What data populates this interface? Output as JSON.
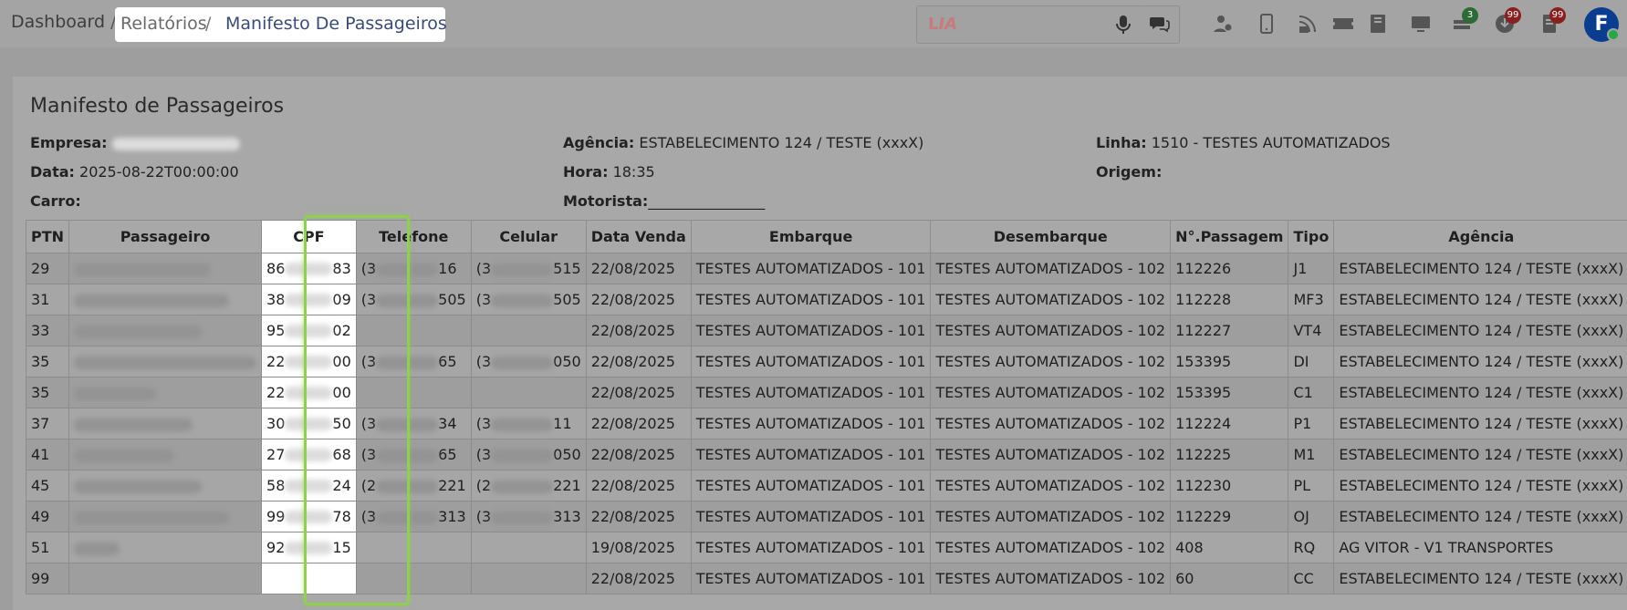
{
  "breadcrumb": {
    "dashboard": "Dashboard",
    "separator": "/",
    "reports": "Relatórios",
    "current": "Manifesto De Passageiros"
  },
  "search": {
    "brand_prefix": "L",
    "brand_suffix": "IA"
  },
  "toolbar": {
    "badges": {
      "green": "3",
      "red1": "99",
      "red2": "99"
    },
    "avatar_initial": "F"
  },
  "manifest": {
    "title": "Manifesto de Passageiros",
    "fields": {
      "empresa_label": "Empresa:",
      "data_label": "Data:",
      "data_value": "2025-08-22T00:00:00",
      "carro_label": "Carro:",
      "agencia_label": "Agência:",
      "agencia_value": "ESTABELECIMENTO 124 / TESTE (xxxX)",
      "hora_label": "Hora:",
      "hora_value": "18:35",
      "motorista_label": "Motorista:",
      "motorista_value": "________________",
      "linha_label": "Linha:",
      "linha_value": "1510 - TESTES AUTOMATIZADOS",
      "origem_label": "Origem:"
    },
    "columns": [
      "PTN",
      "Passageiro",
      "CPF",
      "Telefone",
      "Celular",
      "Data Venda",
      "Embarque",
      "Desembarque",
      "N°.Passagem",
      "Tipo",
      "Agência"
    ],
    "rows": [
      {
        "ptn": "29",
        "cpf_start": "86",
        "cpf_end": "83",
        "tel_start": "(3",
        "tel_end": "16",
        "cel_start": "(3",
        "cel_end": "515",
        "data": "22/08/2025",
        "emb": "TESTES AUTOMATIZADOS - 101",
        "des": "TESTES AUTOMATIZADOS - 102",
        "num": "112226",
        "tipo": "J1",
        "agencia": "ESTABELECIMENTO 124 / TESTE (xxxX)"
      },
      {
        "ptn": "31",
        "cpf_start": "38",
        "cpf_end": "09",
        "tel_start": "(3",
        "tel_end": "505",
        "cel_start": "(3",
        "cel_end": "505",
        "data": "22/08/2025",
        "emb": "TESTES AUTOMATIZADOS - 101",
        "des": "TESTES AUTOMATIZADOS - 102",
        "num": "112228",
        "tipo": "MF3",
        "agencia": "ESTABELECIMENTO 124 / TESTE (xxxX)"
      },
      {
        "ptn": "33",
        "cpf_start": "95",
        "cpf_end": "02",
        "tel_start": "",
        "tel_end": "",
        "cel_start": "",
        "cel_end": "",
        "data": "22/08/2025",
        "emb": "TESTES AUTOMATIZADOS - 101",
        "des": "TESTES AUTOMATIZADOS - 102",
        "num": "112227",
        "tipo": "VT4",
        "agencia": "ESTABELECIMENTO 124 / TESTE (xxxX)"
      },
      {
        "ptn": "35",
        "cpf_start": "22",
        "cpf_end": "00",
        "tel_start": "(3",
        "tel_end": "65",
        "cel_start": "(3",
        "cel_end": "050",
        "data": "22/08/2025",
        "emb": "TESTES AUTOMATIZADOS - 101",
        "des": "TESTES AUTOMATIZADOS - 102",
        "num": "153395",
        "tipo": "DI",
        "agencia": "ESTABELECIMENTO 124 / TESTE (xxxX)"
      },
      {
        "ptn": "35",
        "cpf_start": "22",
        "cpf_end": "00",
        "tel_start": "",
        "tel_end": "",
        "cel_start": "",
        "cel_end": "",
        "data": "22/08/2025",
        "emb": "TESTES AUTOMATIZADOS - 101",
        "des": "TESTES AUTOMATIZADOS - 102",
        "num": "153395",
        "tipo": "C1",
        "agencia": "ESTABELECIMENTO 124 / TESTE (xxxX)"
      },
      {
        "ptn": "37",
        "cpf_start": "30",
        "cpf_end": "50",
        "tel_start": "(3",
        "tel_end": "34",
        "cel_start": "(3",
        "cel_end": "11",
        "data": "22/08/2025",
        "emb": "TESTES AUTOMATIZADOS - 101",
        "des": "TESTES AUTOMATIZADOS - 102",
        "num": "112224",
        "tipo": "P1",
        "agencia": "ESTABELECIMENTO 124 / TESTE (xxxX)"
      },
      {
        "ptn": "41",
        "cpf_start": "27",
        "cpf_end": "68",
        "tel_start": "(3",
        "tel_end": "65",
        "cel_start": "(3",
        "cel_end": "050",
        "data": "22/08/2025",
        "emb": "TESTES AUTOMATIZADOS - 101",
        "des": "TESTES AUTOMATIZADOS - 102",
        "num": "112225",
        "tipo": "M1",
        "agencia": "ESTABELECIMENTO 124 / TESTE (xxxX)"
      },
      {
        "ptn": "45",
        "cpf_start": "58",
        "cpf_end": "24",
        "tel_start": "(2",
        "tel_end": "221",
        "cel_start": "(2",
        "cel_end": "221",
        "data": "22/08/2025",
        "emb": "TESTES AUTOMATIZADOS - 101",
        "des": "TESTES AUTOMATIZADOS - 102",
        "num": "112230",
        "tipo": "PL",
        "agencia": "ESTABELECIMENTO 124 / TESTE (xxxX)"
      },
      {
        "ptn": "49",
        "cpf_start": "99",
        "cpf_end": "78",
        "tel_start": "(3",
        "tel_end": "313",
        "cel_start": "(3",
        "cel_end": "313",
        "data": "22/08/2025",
        "emb": "TESTES AUTOMATIZADOS - 101",
        "des": "TESTES AUTOMATIZADOS - 102",
        "num": "112229",
        "tipo": "OJ",
        "agencia": "ESTABELECIMENTO 124 / TESTE (xxxX)"
      },
      {
        "ptn": "51",
        "cpf_start": "92",
        "cpf_end": "15",
        "tel_start": "",
        "tel_end": "",
        "cel_start": "",
        "cel_end": "",
        "data": "19/08/2025",
        "emb": "TESTES AUTOMATIZADOS - 101",
        "des": "TESTES AUTOMATIZADOS - 102",
        "num": "408",
        "tipo": "RQ",
        "agencia": "AG VITOR - V1 TRANSPORTES"
      },
      {
        "ptn": "99",
        "cpf_start": "",
        "cpf_end": "",
        "tel_start": "",
        "tel_end": "",
        "cel_start": "",
        "cel_end": "",
        "data": "22/08/2025",
        "emb": "TESTES AUTOMATIZADOS - 101",
        "des": "TESTES AUTOMATIZADOS - 102",
        "num": "60",
        "tipo": "CC",
        "agencia": "ESTABELECIMENTO 124 / TESTE (xxxX)"
      }
    ]
  },
  "colors": {
    "highlight_border": "#8fd14f",
    "avatar_bg": "#0a3d8f"
  }
}
